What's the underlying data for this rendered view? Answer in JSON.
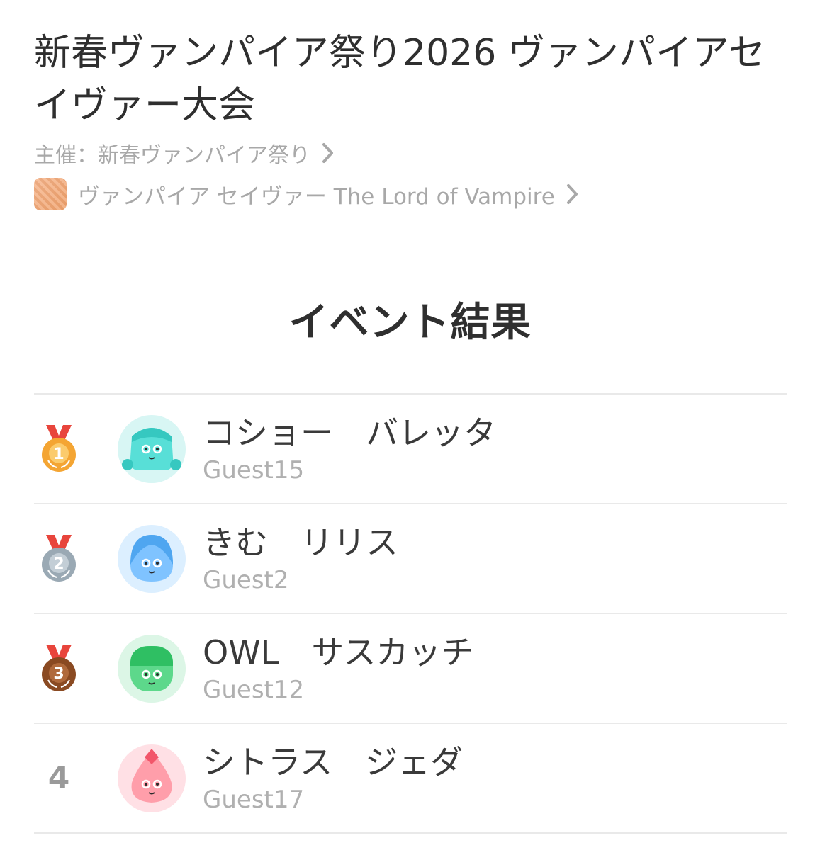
{
  "event": {
    "title": "新春ヴァンパイア祭り2026 ヴァンパイアセイヴァー大会",
    "organizer_label": "主催：新春ヴァンパイア祭り",
    "game_label": "ヴァンパイア セイヴァー The Lord of Vampire"
  },
  "results": {
    "heading": "イベント結果",
    "entries": [
      {
        "rank": "1",
        "medal": "gold-medal-icon",
        "medal_color": "#f4a533",
        "avatar": "cyan-avatar-icon",
        "avatar_color": "#58dfd7",
        "nickname": "コショー　バレッタ",
        "guest": "Guest15"
      },
      {
        "rank": "2",
        "medal": "silver-medal-icon",
        "medal_color": "#9aa9b4",
        "avatar": "blue-avatar-icon",
        "avatar_color": "#7fc3ff",
        "nickname": "きむ　リリス",
        "guest": "Guest2"
      },
      {
        "rank": "3",
        "medal": "bronze-medal-icon",
        "medal_color": "#8a4a22",
        "avatar": "green-avatar-icon",
        "avatar_color": "#5dd88b",
        "nickname": "OWL　サスカッチ",
        "guest": "Guest12"
      },
      {
        "rank": "4",
        "medal": "",
        "medal_color": "",
        "avatar": "pink-avatar-icon",
        "avatar_color": "#ff9eaa",
        "nickname": "シトラス　ジェダ",
        "guest": "Guest17"
      }
    ]
  },
  "colors": {
    "title_text": "#2f2f2f",
    "secondary_text": "#a8a8a8",
    "divider": "#e9e9e9",
    "ribbon_red": "#e8453c"
  }
}
